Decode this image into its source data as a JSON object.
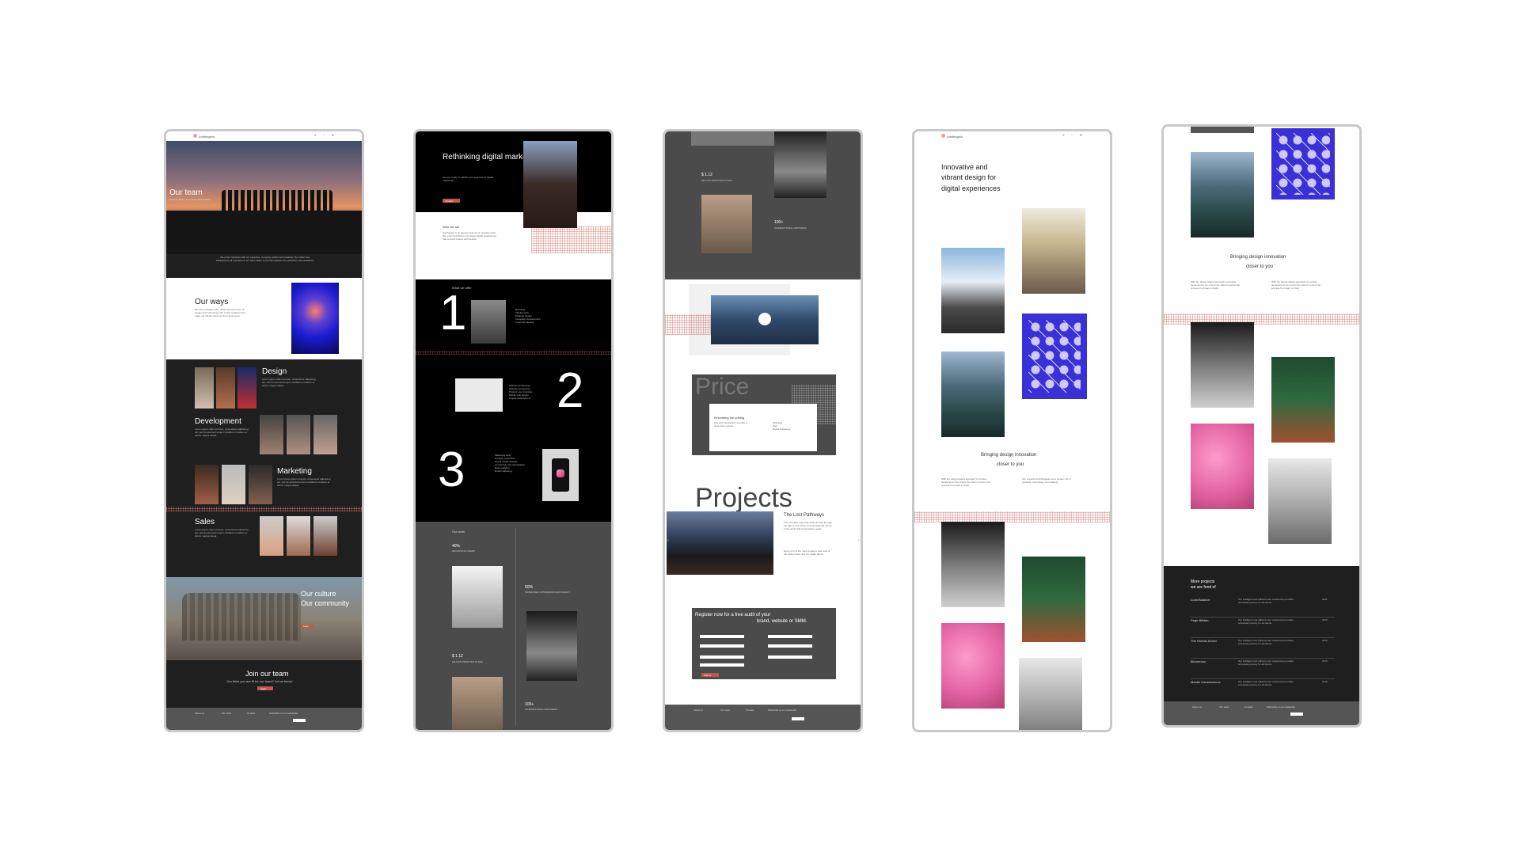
{
  "screen1": {
    "logo": "Aristhagelu",
    "hero_title": "Our team",
    "hero_sub": "Team is always something that matters",
    "intro": "We pride ourselves with our expertise, company culture and creativity. No matter their background, all members of our team share a common passion for perfection and excellence.",
    "ways_title": "Our ways",
    "ways_text": "We are a creative team united around a love of design and technology. We create solutions that make our clients stand out from their peers.",
    "sections": [
      {
        "title": "Design",
        "text": "Lorem ipsum dolor sit amet, consectetur adipiscing elit, sed do eiusmod tempor incididunt ut labore et dolore magna aliqua."
      },
      {
        "title": "Development",
        "text": "Lorem ipsum dolor sit amet, consectetur adipiscing elit, sed do eiusmod tempor incididunt ut labore et dolore magna aliqua."
      },
      {
        "title": "Marketing",
        "text": "Lorem ipsum dolor sit amet, consectetur adipiscing elit, sed do eiusmod tempor incididunt ut labore et dolore magna aliqua."
      },
      {
        "title": "Sales",
        "text": "Lorem ipsum dolor sit amet, consectetur adipiscing elit, sed do eiusmod tempor incididunt ut labore et dolore magna aliqua."
      }
    ],
    "culture_1": "Our culture",
    "culture_2": "Our community",
    "culture_btn": "More",
    "join_title": "Join our team",
    "join_sub": "You think you are fit for our team? Let us know!",
    "join_btn": "Apply"
  },
  "screen2": {
    "hero_title": "Rethinking digital marketing.",
    "hero_text": "Are you ready to rethink your approach to digital marketing?",
    "hero_btn": "Contact",
    "who_title": "Who we are",
    "who_text": "Aristhagelu is an agency focused on creative work. We push boundaries and shape digital experiences that connect brands with people.",
    "offer_title": "What we offer",
    "num1": "1",
    "num2": "2",
    "num3": "3",
    "list1": [
      "Branding",
      "Identity work",
      "Strategy design",
      "Campaign development",
      "Customer identity"
    ],
    "list2": [
      "Website architecture",
      "Website prototyping",
      "Product user interface",
      "Mobile web design",
      "Project development"
    ],
    "list3": [
      "Marketing audit",
      "Content production",
      "Social media strategy",
      "Conversion rate optimisation",
      "Data analytics",
      "Email marketing"
    ],
    "work_title": "Our work",
    "stat1_value": "40%",
    "stat1_label": "RETURNING USERS",
    "stat2_value": "60%",
    "stat2_label": "INCREASED CONVERSION EFFICIENCY",
    "stat3_value": "$ 1.12",
    "stat3_label": "MILLION PROFITED IN ADS",
    "stat4_value": "100+",
    "stat4_label": "INTERNATIONAL PARTNERS"
  },
  "screen3": {
    "stat_value": "$ 1.12",
    "stat_label": "MILLION PROFITED IN ADS",
    "stat2_value": "100+",
    "stat2_label": "INTERNATIONAL PARTNERS",
    "price_title": "Price",
    "pricing_title": "Innovating the pricing",
    "pricing_text": "Fair and transparent, we offer a clear price system.",
    "pricing_items": [
      "Branding",
      "Web",
      "Digital Marketing"
    ],
    "projects_title": "Projects",
    "project_name": "The Lost Pathways",
    "project_text": "The mountain pass that winds its way through the Alps is one of the most spectacular drives in the world, full of serpentine roads.",
    "project_text2": "Every turn of the road reveals a new view of the valley below and the peaks above.",
    "register_line1": "Register now for a free audit of your",
    "register_line2": "brand, website or SMM.",
    "register_btn": "Submit"
  },
  "screen4": {
    "logo": "Aristhagelu",
    "hero_title_1": "Innovative and",
    "hero_title_2": "vibrant design for",
    "hero_title_3": "digital experiences",
    "bring_1": "Bringing design innovation",
    "bring_2": "closer to you",
    "bring_text": "With the design-based approach to product development we ensure the client is part of the process from start to finish.",
    "bring_text2": "Our projects at Aristhagelu are a unique mix of creativity, technology and strategy."
  },
  "screen5": {
    "bring_1": "Bringing design innovation",
    "bring_2": "closer to you",
    "bring_text": "With the design-based approach to product development we ensure the client is part of the process from start to finish.",
    "more_title_1": "More projects",
    "more_title_2": "we are fond of",
    "projects": [
      {
        "name": "Luna Balance",
        "year": "2021"
      },
      {
        "name": "Page Bikitab",
        "year": "2020"
      },
      {
        "name": "The Human Annex",
        "year": "2019"
      },
      {
        "name": "Bloomrous",
        "year": "2019"
      },
      {
        "name": "Mantle Constructions",
        "year": "2018"
      }
    ],
    "project_desc": "Our intelligent and efficient user experience provides a bespoke journey for all clients."
  },
  "footer": {
    "col1": "About us",
    "col2": "Our work",
    "col3": "Contact",
    "col4": "Subscribe to our newsletter",
    "btn": "Subscribe"
  },
  "colors": {
    "dark": "#1f1f1f",
    "grey": "#4a4a4a",
    "accent": "#c0584a",
    "frame_border": "#c9c9c9",
    "pattern_blue": "#3a30d8"
  }
}
